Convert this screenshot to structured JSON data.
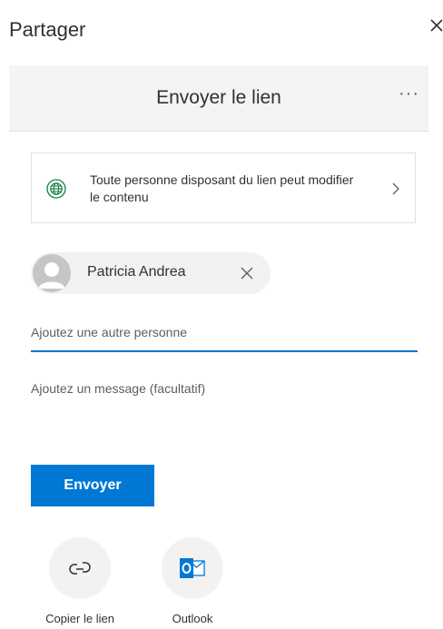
{
  "dialog": {
    "title": "Partager",
    "close_icon": "close-icon"
  },
  "header": {
    "title": "Envoyer le lien",
    "more_label": "···"
  },
  "permission": {
    "icon": "globe-icon",
    "text": "Toute personne disposant du lien peut modifier le contenu"
  },
  "recipient": {
    "name": "Patricia Andrea"
  },
  "add_person": {
    "placeholder": "Ajoutez une autre personne",
    "value": ""
  },
  "message": {
    "placeholder": "Ajoutez un message (facultatif)",
    "value": ""
  },
  "send_button": {
    "label": "Envoyer"
  },
  "share_options": [
    {
      "label": "Copier le lien",
      "icon": "link-icon"
    },
    {
      "label": "Outlook",
      "icon": "outlook-icon"
    }
  ],
  "colors": {
    "accent": "#0078d4",
    "globe": "#107c41",
    "outlook": "#0078d4"
  }
}
